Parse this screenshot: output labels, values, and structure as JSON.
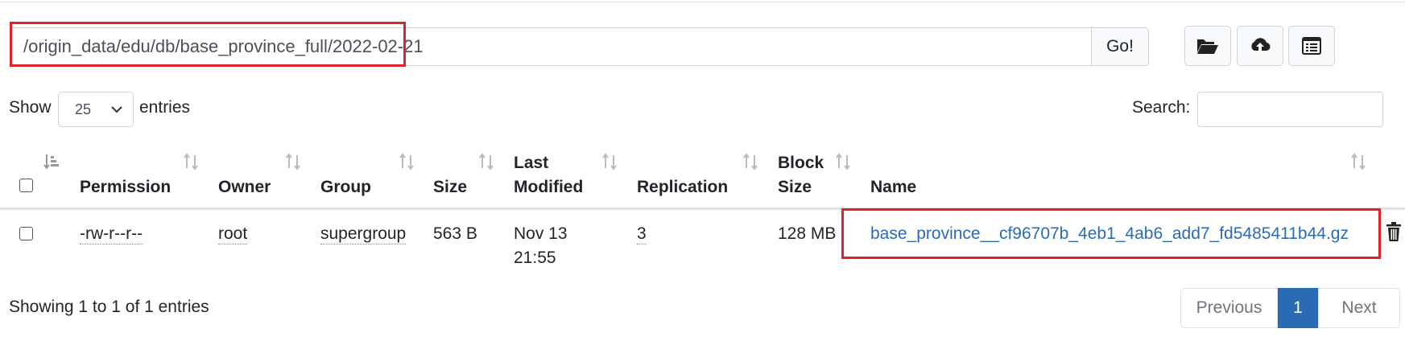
{
  "path_bar": {
    "path_value": "/origin_data/edu/db/base_province_full/2022-02-21",
    "go_label": "Go!",
    "icons": [
      "folder-open-icon",
      "cloud-upload-icon",
      "list-alt-icon"
    ]
  },
  "length_control": {
    "show_label": "Show",
    "selected": "25",
    "entries_label": "entries"
  },
  "search": {
    "label": "Search:",
    "value": ""
  },
  "table": {
    "columns": {
      "permission": "Permission",
      "owner": "Owner",
      "group": "Group",
      "size": "Size",
      "last_modified_1": "Last",
      "last_modified_2": "Modified",
      "replication": "Replication",
      "block_size_1": "Block",
      "block_size_2": "Size",
      "name": "Name"
    },
    "rows": [
      {
        "permission": "-rw-r--r--",
        "owner": "root",
        "group": "supergroup",
        "size": "563 B",
        "modified_1": "Nov 13",
        "modified_2": "21:55",
        "replication": "3",
        "block_size": "128 MB",
        "name": "base_province__cf96707b_4eb1_4ab6_add7_fd5485411b44.gz"
      }
    ]
  },
  "info": "Showing 1 to 1 of 1 entries",
  "pagination": {
    "previous": "Previous",
    "current_page": "1",
    "next": "Next"
  },
  "colors": {
    "highlight": "#e0222a",
    "link": "#2a6bb3",
    "active_page": "#2a6bb3"
  }
}
